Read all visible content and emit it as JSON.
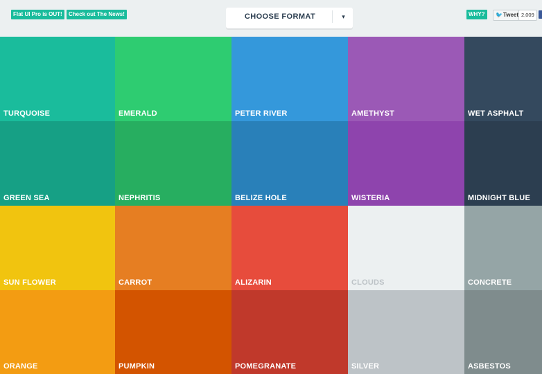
{
  "header": {
    "promo_tag": "Flat UI Pro is OUT!",
    "news_tag": "Check out The News!",
    "format_select": {
      "label": "CHOOSE FORMAT",
      "caret": "▾"
    },
    "why_tag": "WHY?",
    "tweet": {
      "label": "Tweet",
      "count": "2,009",
      "icon": "twitter-bird-icon"
    },
    "facebook_icon": "facebook-icon"
  },
  "accent_color": "#1abc9c",
  "colors": [
    {
      "name": "TURQUOISE",
      "hex": "#1abc9c"
    },
    {
      "name": "EMERALD",
      "hex": "#2ecc71"
    },
    {
      "name": "PETER RIVER",
      "hex": "#3498db"
    },
    {
      "name": "AMETHYST",
      "hex": "#9b59b6"
    },
    {
      "name": "WET ASPHALT",
      "hex": "#34495e"
    },
    {
      "name": "GREEN SEA",
      "hex": "#16a085"
    },
    {
      "name": "NEPHRITIS",
      "hex": "#27ae60"
    },
    {
      "name": "BELIZE HOLE",
      "hex": "#2980b9"
    },
    {
      "name": "WISTERIA",
      "hex": "#8e44ad"
    },
    {
      "name": "MIDNIGHT BLUE",
      "hex": "#2c3e50"
    },
    {
      "name": "SUN FLOWER",
      "hex": "#f1c40f"
    },
    {
      "name": "CARROT",
      "hex": "#e67e22"
    },
    {
      "name": "ALIZARIN",
      "hex": "#e74c3c"
    },
    {
      "name": "CLOUDS",
      "hex": "#ecf0f1"
    },
    {
      "name": "CONCRETE",
      "hex": "#95a5a6"
    },
    {
      "name": "ORANGE",
      "hex": "#f39c12"
    },
    {
      "name": "PUMPKIN",
      "hex": "#d35400"
    },
    {
      "name": "POMEGRANATE",
      "hex": "#c0392b"
    },
    {
      "name": "SILVER",
      "hex": "#bdc3c7"
    },
    {
      "name": "ASBESTOS",
      "hex": "#7f8c8d"
    }
  ]
}
